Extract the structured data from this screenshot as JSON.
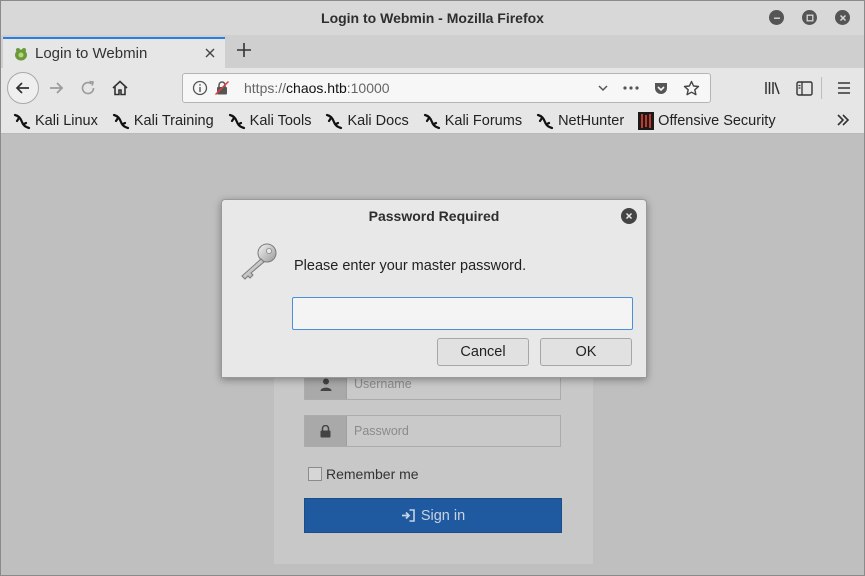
{
  "window": {
    "title": "Login to Webmin - Mozilla Firefox"
  },
  "tabs": [
    {
      "label": "Login to Webmin",
      "active": true
    }
  ],
  "navbar": {
    "url_prefix": "https://",
    "url_host": "chaos.htb",
    "url_suffix": ":10000"
  },
  "bookmarks": [
    {
      "label": "Kali Linux",
      "icon": "kali-dragon-icon"
    },
    {
      "label": "Kali Training",
      "icon": "kali-dragon-icon"
    },
    {
      "label": "Kali Tools",
      "icon": "kali-dragon-icon"
    },
    {
      "label": "Kali Docs",
      "icon": "kali-dragon-icon"
    },
    {
      "label": "Kali Forums",
      "icon": "kali-dragon-icon"
    },
    {
      "label": "NetHunter",
      "icon": "kali-dragon-icon"
    },
    {
      "label": "Offensive Security",
      "icon": "offsec-icon"
    }
  ],
  "login_form": {
    "username_placeholder": "Username",
    "password_placeholder": "Password",
    "remember_label": "Remember me",
    "signin_label": "Sign in"
  },
  "dialog": {
    "title": "Password Required",
    "message": "Please enter your master password.",
    "input_value": "",
    "cancel_label": "Cancel",
    "ok_label": "OK"
  },
  "colors": {
    "accent": "#2a7de1",
    "signin_button": "#1f5aa0",
    "focus_border": "#4a90d9"
  }
}
